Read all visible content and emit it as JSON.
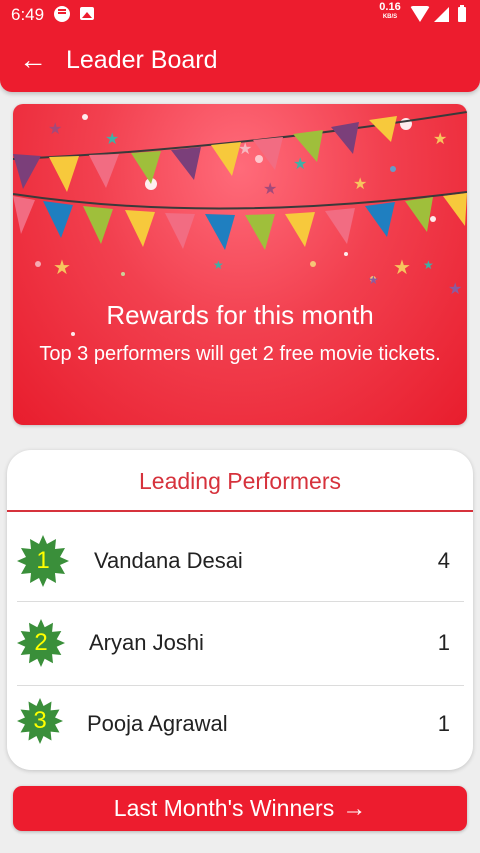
{
  "status_bar": {
    "time": "6:49",
    "speed_value": "0.16",
    "speed_unit": "KB/S",
    "icons": [
      "message-icon",
      "image-icon",
      "wifi-icon",
      "signal-icon",
      "battery-icon"
    ]
  },
  "app_bar": {
    "back_icon": "arrow-left-icon",
    "title": "Leader Board",
    "color": "#ed1c2e"
  },
  "banner": {
    "title": "Rewards for this month",
    "subtitle": "Top 3 performers will get 2 free movie tickets."
  },
  "leaderboard": {
    "title": "Leading Performers",
    "accent": "#d6323c",
    "badge_color": "#3a8f3a",
    "badge_text_color": "#ffff00",
    "rows": [
      {
        "rank": "1",
        "name": "Vandana Desai",
        "score": "4"
      },
      {
        "rank": "2",
        "name": "Aryan Joshi",
        "score": "1"
      },
      {
        "rank": "3",
        "name": "Pooja Agrawal",
        "score": "1"
      }
    ]
  },
  "winners_button": {
    "label": "Last Month's Winners",
    "icon": "arrow-right-icon"
  }
}
